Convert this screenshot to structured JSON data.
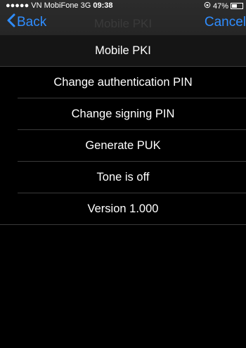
{
  "status_bar": {
    "signal": "●●●●●",
    "carrier": "VN MobiFone",
    "network": "3G",
    "time": "09:38",
    "battery_percent": "47%",
    "battery_level": 0.47
  },
  "nav": {
    "back_label": "Back",
    "title": "Mobile PKI",
    "cancel_label": "Cancel",
    "accent_color": "#2f8dff"
  },
  "menu": {
    "items": [
      {
        "label": "Mobile PKI"
      },
      {
        "label": "Change authentication PIN"
      },
      {
        "label": "Change signing PIN"
      },
      {
        "label": "Generate PUK"
      },
      {
        "label": "Tone is off"
      },
      {
        "label": "Version 1.000"
      }
    ]
  }
}
